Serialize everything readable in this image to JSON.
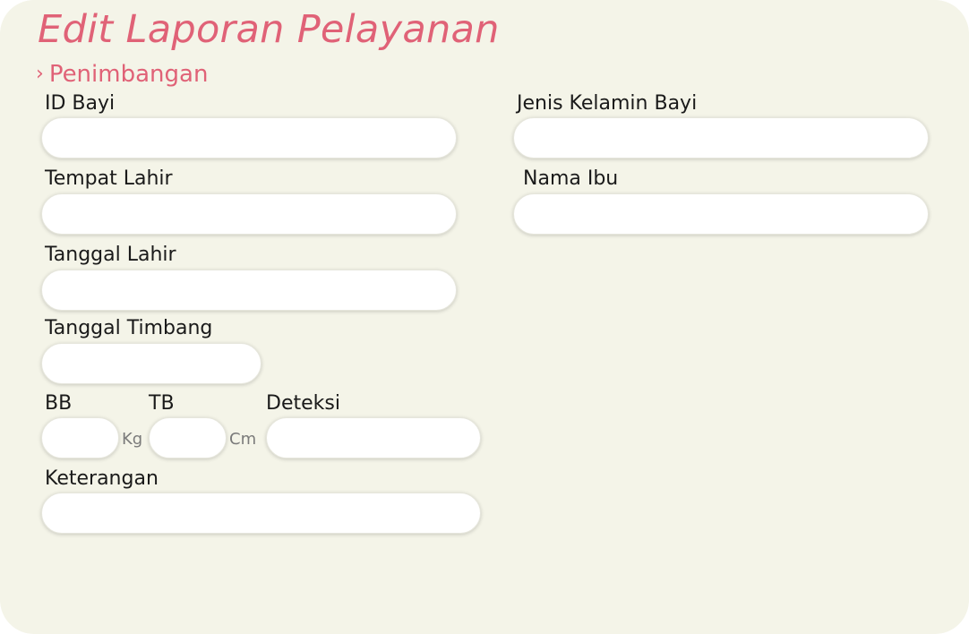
{
  "header": {
    "title": "Edit Laporan Pelayanan",
    "breadcrumb_chevron": "›",
    "breadcrumb_label": "Penimbangan"
  },
  "form": {
    "id_bayi": {
      "label": "ID Bayi",
      "value": ""
    },
    "jenis_kelamin": {
      "label": "Jenis Kelamin Bayi",
      "value": ""
    },
    "tempat_lahir": {
      "label": "Tempat Lahir",
      "value": ""
    },
    "nama_ibu": {
      "label": "Nama Ibu",
      "value": ""
    },
    "tanggal_lahir": {
      "label": "Tanggal Lahir",
      "value": ""
    },
    "tanggal_timbang": {
      "label": "Tanggal Timbang",
      "value": ""
    },
    "bb": {
      "label": "BB",
      "value": "",
      "unit": "Kg"
    },
    "tb": {
      "label": "TB",
      "value": "",
      "unit": "Cm"
    },
    "deteksi": {
      "label": "Deteksi",
      "value": ""
    },
    "keterangan": {
      "label": "Keterangan",
      "value": ""
    }
  },
  "colors": {
    "accent": "#e06277",
    "background": "#f4f4e8",
    "field": "#ffffff"
  }
}
